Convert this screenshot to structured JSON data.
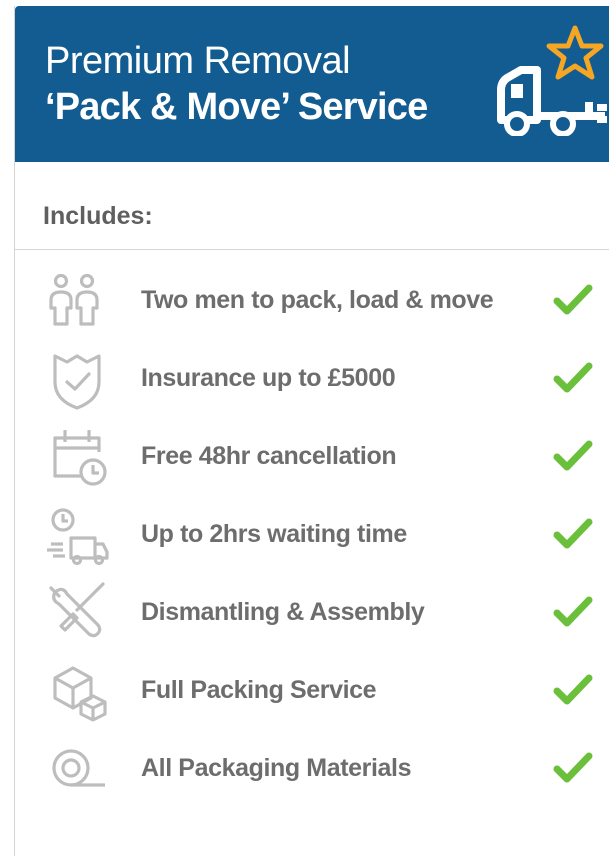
{
  "colors": {
    "header_bg": "#135c91",
    "header_text": "#ffffff",
    "star_accent": "#f5a623",
    "check_green": "#6abf3b",
    "icon_gray": "#bdbdbd",
    "label_gray": "#6d6d6d"
  },
  "header": {
    "title_line1": "Premium Removal",
    "title_line2": "‘Pack & Move’ Service",
    "icon": "truck-star-icon"
  },
  "includes_label": "Includes:",
  "features": [
    {
      "label": "Two men to pack, load & move",
      "icon": "two-men-icon",
      "included": true
    },
    {
      "label": "Insurance up to £5000",
      "icon": "shield-check-icon",
      "included": true
    },
    {
      "label": "Free 48hr cancellation",
      "icon": "calendar-clock-icon",
      "included": true
    },
    {
      "label": "Up to 2hrs waiting time",
      "icon": "clock-truck-icon",
      "included": true
    },
    {
      "label": "Dismantling & Assembly",
      "icon": "tools-icon",
      "included": true
    },
    {
      "label": "Full Packing Service",
      "icon": "boxes-icon",
      "included": true
    },
    {
      "label": "All Packaging Materials",
      "icon": "tape-roll-icon",
      "included": true
    }
  ]
}
